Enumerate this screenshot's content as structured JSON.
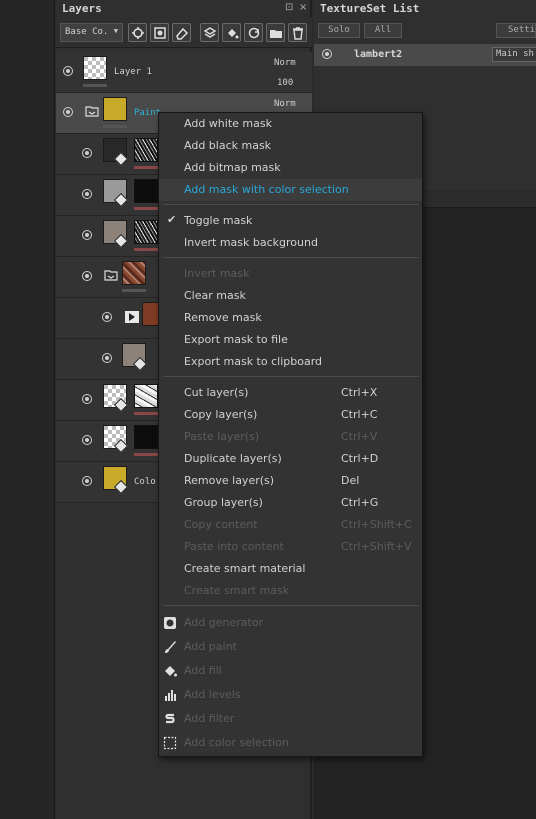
{
  "layers_panel": {
    "title": "Layers",
    "title_controls": [
      "⊡",
      "×"
    ],
    "blend_mode": "Base Co.",
    "layers": [
      {
        "name": "Layer 1",
        "blend": "Norm",
        "opacity": "100"
      },
      {
        "name": "Paint in Pol",
        "blend": "Norm"
      },
      {
        "name": ""
      },
      {
        "name": ""
      },
      {
        "name": ""
      },
      {
        "name": ""
      },
      {
        "name": ""
      },
      {
        "name": ""
      },
      {
        "name": ""
      },
      {
        "name": ""
      },
      {
        "name": "Colo"
      }
    ]
  },
  "textureset_panel": {
    "title": "TextureSet List",
    "solo_label": "Solo",
    "all_label": "All",
    "settings_label": "Setti",
    "row_name": "lambert2",
    "row_button": "Main sh"
  },
  "context_menu": {
    "mask_add": [
      {
        "label": "Add white mask",
        "state": "normal"
      },
      {
        "label": "Add black mask",
        "state": "normal"
      },
      {
        "label": "Add bitmap mask",
        "state": "normal"
      },
      {
        "label": "Add mask with color selection",
        "state": "highlight"
      }
    ],
    "mask_toggle": [
      {
        "label": "Toggle mask",
        "checked": "✔",
        "state": "normal"
      },
      {
        "label": "Invert mask background",
        "state": "normal"
      }
    ],
    "mask_ops": [
      {
        "label": "Invert mask",
        "state": "disabled"
      },
      {
        "label": "Clear mask",
        "state": "normal"
      },
      {
        "label": "Remove mask",
        "state": "normal"
      },
      {
        "label": "Export mask to file",
        "state": "normal"
      },
      {
        "label": "Export mask to clipboard",
        "state": "normal"
      }
    ],
    "layer_ops": [
      {
        "label": "Cut layer(s)",
        "shortcut": "Ctrl+X",
        "state": "normal"
      },
      {
        "label": "Copy layer(s)",
        "shortcut": "Ctrl+C",
        "state": "normal"
      },
      {
        "label": "Paste layer(s)",
        "shortcut": "Ctrl+V",
        "state": "disabled"
      },
      {
        "label": "Duplicate layer(s)",
        "shortcut": "Ctrl+D",
        "state": "normal"
      },
      {
        "label": "Remove layer(s)",
        "shortcut": "Del",
        "state": "normal"
      },
      {
        "label": "Group layer(s)",
        "shortcut": "Ctrl+G",
        "state": "normal"
      },
      {
        "label": "Copy content",
        "shortcut": "Ctrl+Shift+C",
        "state": "disabled"
      },
      {
        "label": "Paste into content",
        "shortcut": "Ctrl+Shift+V",
        "state": "disabled"
      },
      {
        "label": "Create smart material",
        "state": "normal"
      },
      {
        "label": "Create smart mask",
        "state": "disabled"
      }
    ],
    "effects": [
      {
        "label": "Add generator",
        "icon": "generator-icon",
        "state": "disabled"
      },
      {
        "label": "Add paint",
        "icon": "brush-icon",
        "state": "disabled"
      },
      {
        "label": "Add fill",
        "icon": "fill-bucket-icon",
        "state": "disabled"
      },
      {
        "label": "Add levels",
        "icon": "levels-icon",
        "state": "disabled"
      },
      {
        "label": "Add filter",
        "icon": "filter-icon",
        "state": "disabled"
      },
      {
        "label": "Add color selection",
        "icon": "color-selection-icon",
        "state": "disabled"
      }
    ]
  },
  "colors": {
    "highlight_text": "#29a8d6",
    "selected_layer_name": "#29b3d6",
    "disabled_text": "#5c5c5c",
    "mask_bar_red": "#8a4747"
  }
}
